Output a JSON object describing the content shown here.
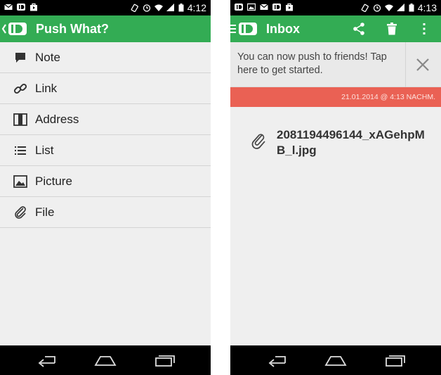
{
  "left_screen": {
    "status_bar": {
      "time": "4:12"
    },
    "app_bar": {
      "title": "Push What?"
    },
    "menu": [
      {
        "label": "Note",
        "icon": "note-icon"
      },
      {
        "label": "Link",
        "icon": "link-icon"
      },
      {
        "label": "Address",
        "icon": "address-icon"
      },
      {
        "label": "List",
        "icon": "list-icon"
      },
      {
        "label": "Picture",
        "icon": "picture-icon"
      },
      {
        "label": "File",
        "icon": "file-icon"
      }
    ]
  },
  "right_screen": {
    "status_bar": {
      "time": "4:13"
    },
    "app_bar": {
      "title": "Inbox"
    },
    "banner": {
      "text": "You can now push to friends! Tap here to get started."
    },
    "date": "21.01.2014 @ 4:13 NACHM.",
    "push": {
      "file_name": "2081194496144_xAGehpMB_l.jpg",
      "icon": "paperclip-icon"
    }
  },
  "colors": {
    "accent": "#33ac54",
    "date_strip": "#ea6154",
    "background": "#efefef"
  }
}
